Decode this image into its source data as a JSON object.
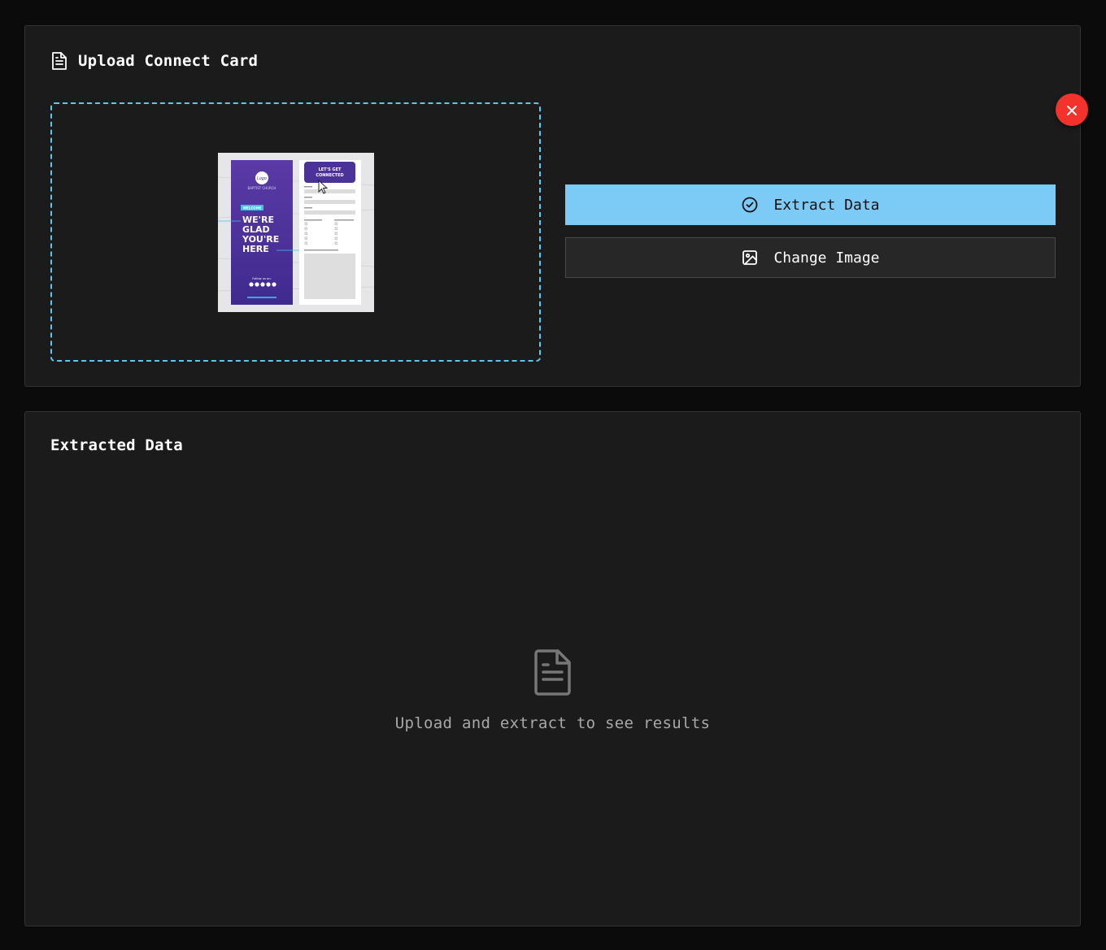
{
  "upload_panel": {
    "title": "Upload Connect Card",
    "title_icon": "file-text-icon",
    "close_icon": "close-icon",
    "extract_button": {
      "label": "Extract Data",
      "icon": "check-circle-icon"
    },
    "change_button": {
      "label": "Change Image",
      "icon": "image-icon"
    },
    "preview": {
      "left_panel": {
        "logo": "Logo",
        "church": "BAPTIST CHURCH",
        "badge": "WELCOME",
        "headline_lines": [
          "WE'RE",
          "GLAD",
          "YOU'RE",
          "HERE"
        ],
        "follow": "Follow us on:"
      },
      "right_panel": {
        "header_lines": [
          "LET'S GET",
          "CONNECTED"
        ]
      }
    }
  },
  "result_panel": {
    "title": "Extracted Data",
    "empty_icon": "file-text-icon",
    "empty_message": "Upload and extract to see results"
  },
  "colors": {
    "accent": "#7ccbf6",
    "dropzone_border": "#5cc8ef",
    "close": "#f3322b",
    "panel_bg": "#1b1b1b",
    "page_bg": "#0b0b0b"
  }
}
